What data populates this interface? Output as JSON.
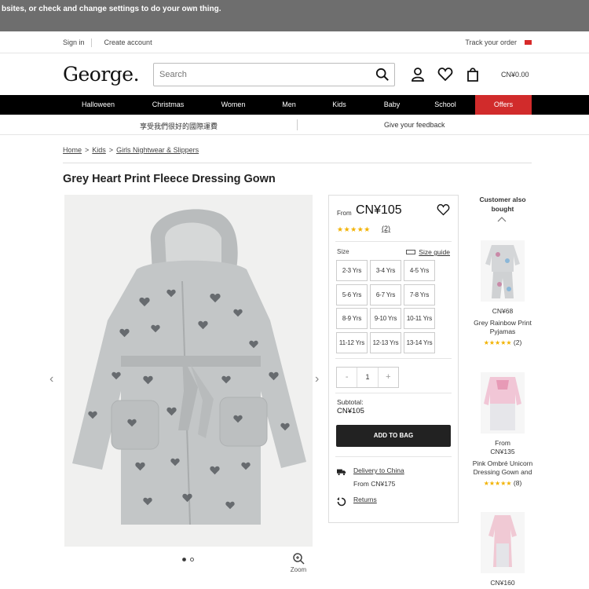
{
  "cookie_bar": {
    "text": "bsites, or check and change settings to do your own thing."
  },
  "util": {
    "sign_in": "Sign in",
    "create_account": "Create account",
    "track_order": "Track your order"
  },
  "header": {
    "logo": "George.",
    "search_placeholder": "Search",
    "basket_total": "CN¥0.00"
  },
  "nav": [
    {
      "label": "Halloween"
    },
    {
      "label": "Christmas"
    },
    {
      "label": "Women"
    },
    {
      "label": "Men"
    },
    {
      "label": "Kids"
    },
    {
      "label": "Baby"
    },
    {
      "label": "School"
    },
    {
      "label": "Offers"
    }
  ],
  "promo": {
    "left": "享受我們很好的國際運費",
    "right": "Give your feedback"
  },
  "breadcrumb": [
    {
      "label": "Home"
    },
    {
      "sep": ">"
    },
    {
      "label": "Kids"
    },
    {
      "sep": ">"
    },
    {
      "label": "Girls Nightwear & Slippers"
    }
  ],
  "product": {
    "title": "Grey Heart Print Fleece Dressing Gown",
    "from_label": "From",
    "price": "CN¥105",
    "stars": "★★★★★",
    "rating": 5,
    "review_count": "(2)",
    "size_label": "Size",
    "size_guide": "Size guide",
    "sizes": [
      "2-3 Yrs",
      "3-4 Yrs",
      "4-5 Yrs",
      "5-6 Yrs",
      "6-7 Yrs",
      "7-8 Yrs",
      "8-9 Yrs",
      "9-10 Yrs",
      "10-11 Yrs",
      "11-12 Yrs",
      "12-13 Yrs",
      "13-14 Yrs"
    ],
    "qty_minus": "-",
    "qty_value": "1",
    "qty_plus": "+",
    "subtotal_label": "Subtotal:",
    "subtotal_value": "CN¥105",
    "add_to_bag": "ADD TO BAG",
    "delivery_link": "Delivery to China",
    "delivery_price": "From CN¥175",
    "returns_link": "Returns",
    "zoom_label": "Zoom",
    "images_total": 2,
    "images_active": 1
  },
  "recs": {
    "title": "Customer also bought",
    "items": [
      {
        "price": "CN¥68",
        "name": "Grey Rainbow Print Pyjamas",
        "stars": "★★★★★",
        "count": "(2)"
      },
      {
        "from": "From",
        "price": "CN¥135",
        "name": "Pink Ombré Unicorn Dressing Gown and",
        "stars": "★★★★★",
        "count": "(8)"
      },
      {
        "price": "CN¥160"
      }
    ]
  },
  "colors": {
    "nav_bg": "#000000",
    "offers_bg": "#d12b2b",
    "star": "#f2b200",
    "gown": "#c3c6c7",
    "heart": "#585c60"
  }
}
